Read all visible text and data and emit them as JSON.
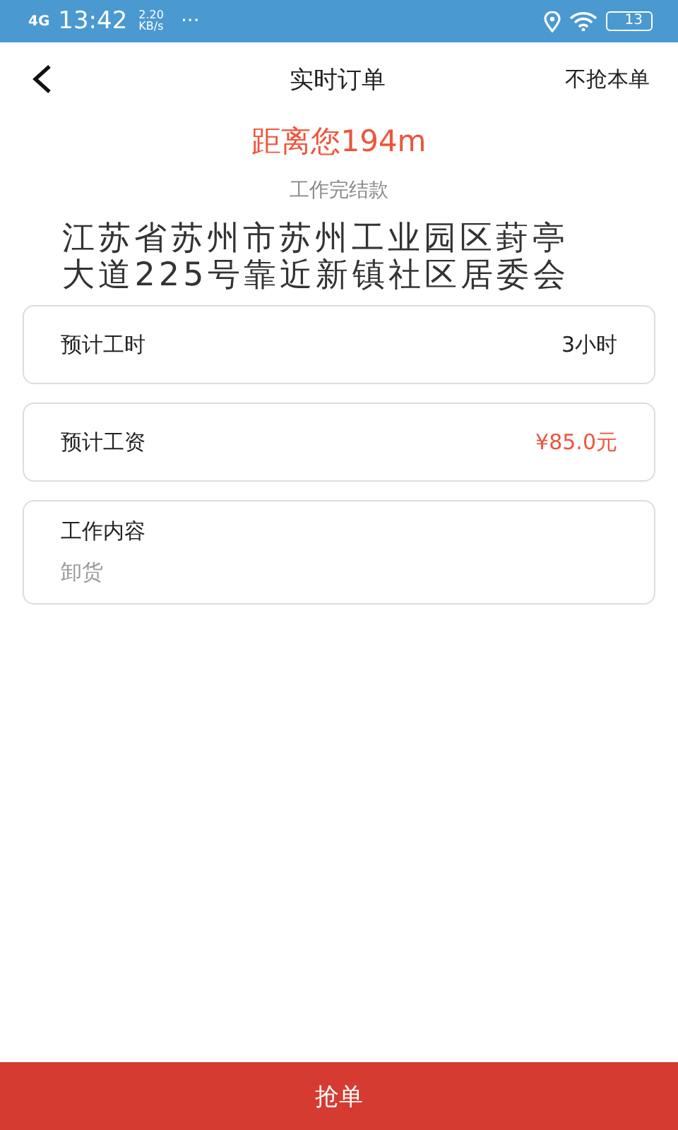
{
  "status_bar": {
    "network": "4G",
    "time": "13:42",
    "speed_value": "2.20",
    "speed_unit": "KB/s",
    "more": "···",
    "battery": "13"
  },
  "header": {
    "title": "实时订单",
    "action": "不抢本单"
  },
  "distance": "距离您194m",
  "payment_type": "工作完结款",
  "address": "江苏省苏州市苏州工业园区葑亭大道225号靠近新镇社区居委会",
  "cards": [
    {
      "kind": "row",
      "label": "预计工时",
      "value": "3小时",
      "highlight": false
    },
    {
      "kind": "row",
      "label": "预计工资",
      "value": "¥85.0元",
      "highlight": true
    },
    {
      "kind": "block",
      "label": "工作内容",
      "value": "卸货"
    }
  ],
  "button": "抢单"
}
